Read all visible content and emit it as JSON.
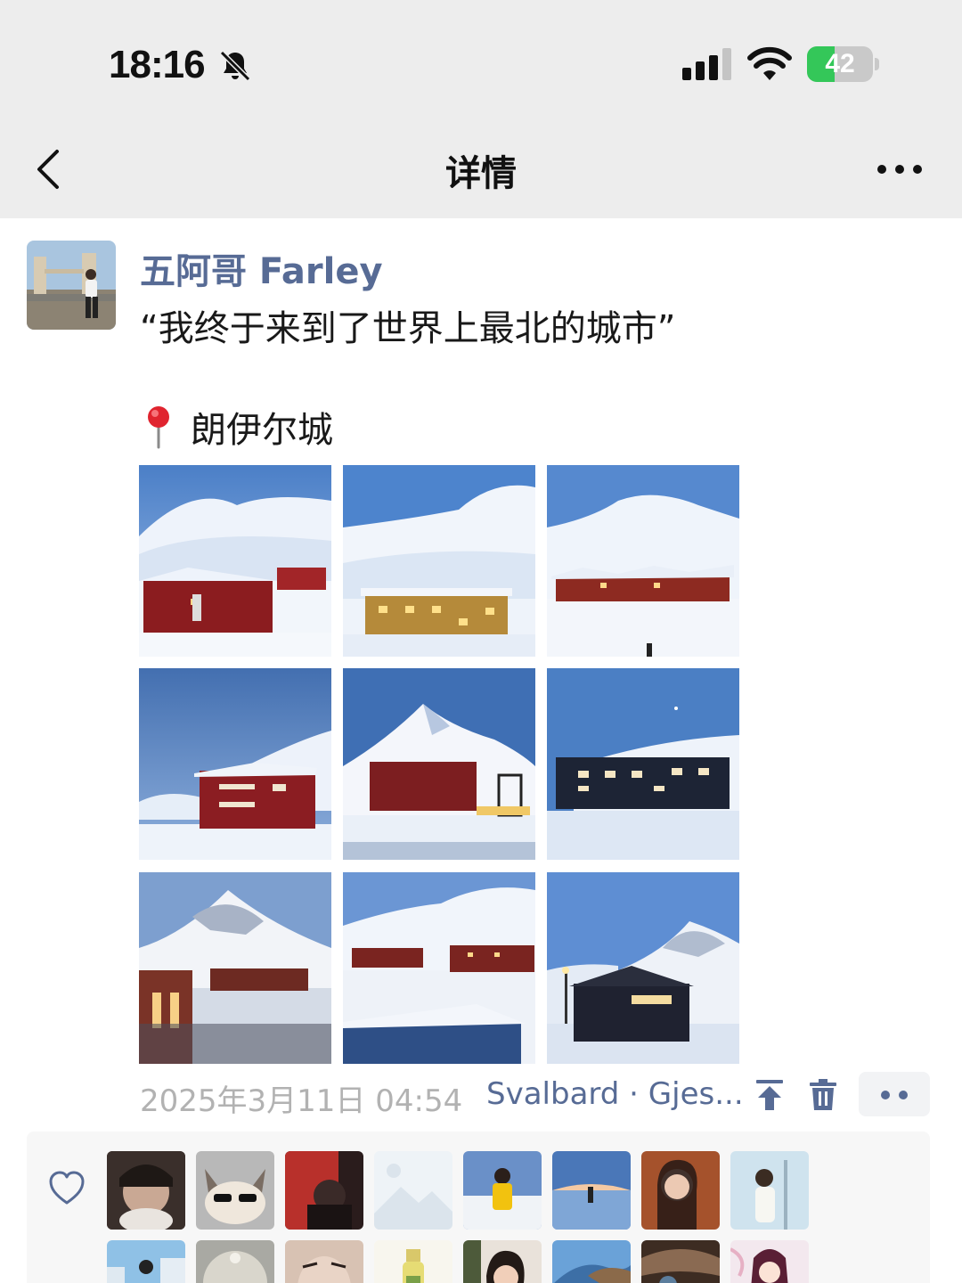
{
  "status_bar": {
    "time": "18:16",
    "battery_percent": "42",
    "battery_level": 0.42,
    "icons": [
      "bell-muted-icon",
      "cellular-signal-icon",
      "wifi-icon",
      "battery-charging-icon"
    ]
  },
  "nav": {
    "title": "详情",
    "back_icon": "chevron-left-icon",
    "more_icon": "ellipsis-icon"
  },
  "post": {
    "author": "五阿哥 Farley",
    "text": "“我终于来到了世界上最北的城市”",
    "location_emoji": "pin-icon",
    "location_text": "朗伊尔城",
    "photo_count": 9,
    "timestamp": "2025年3月11日 04:54",
    "place": "Svalbard · Gjes..."
  },
  "actions": {
    "icons": [
      "pin-to-top-icon",
      "trash-icon",
      "more-options-icon"
    ]
  },
  "likes": {
    "icon": "heart-icon"
  },
  "colors": {
    "link": "#576b95",
    "meta_gray": "#b2b2b2",
    "nav_bg": "#ededed",
    "likes_bg": "#f7f7f7",
    "battery_green": "#34c759"
  }
}
